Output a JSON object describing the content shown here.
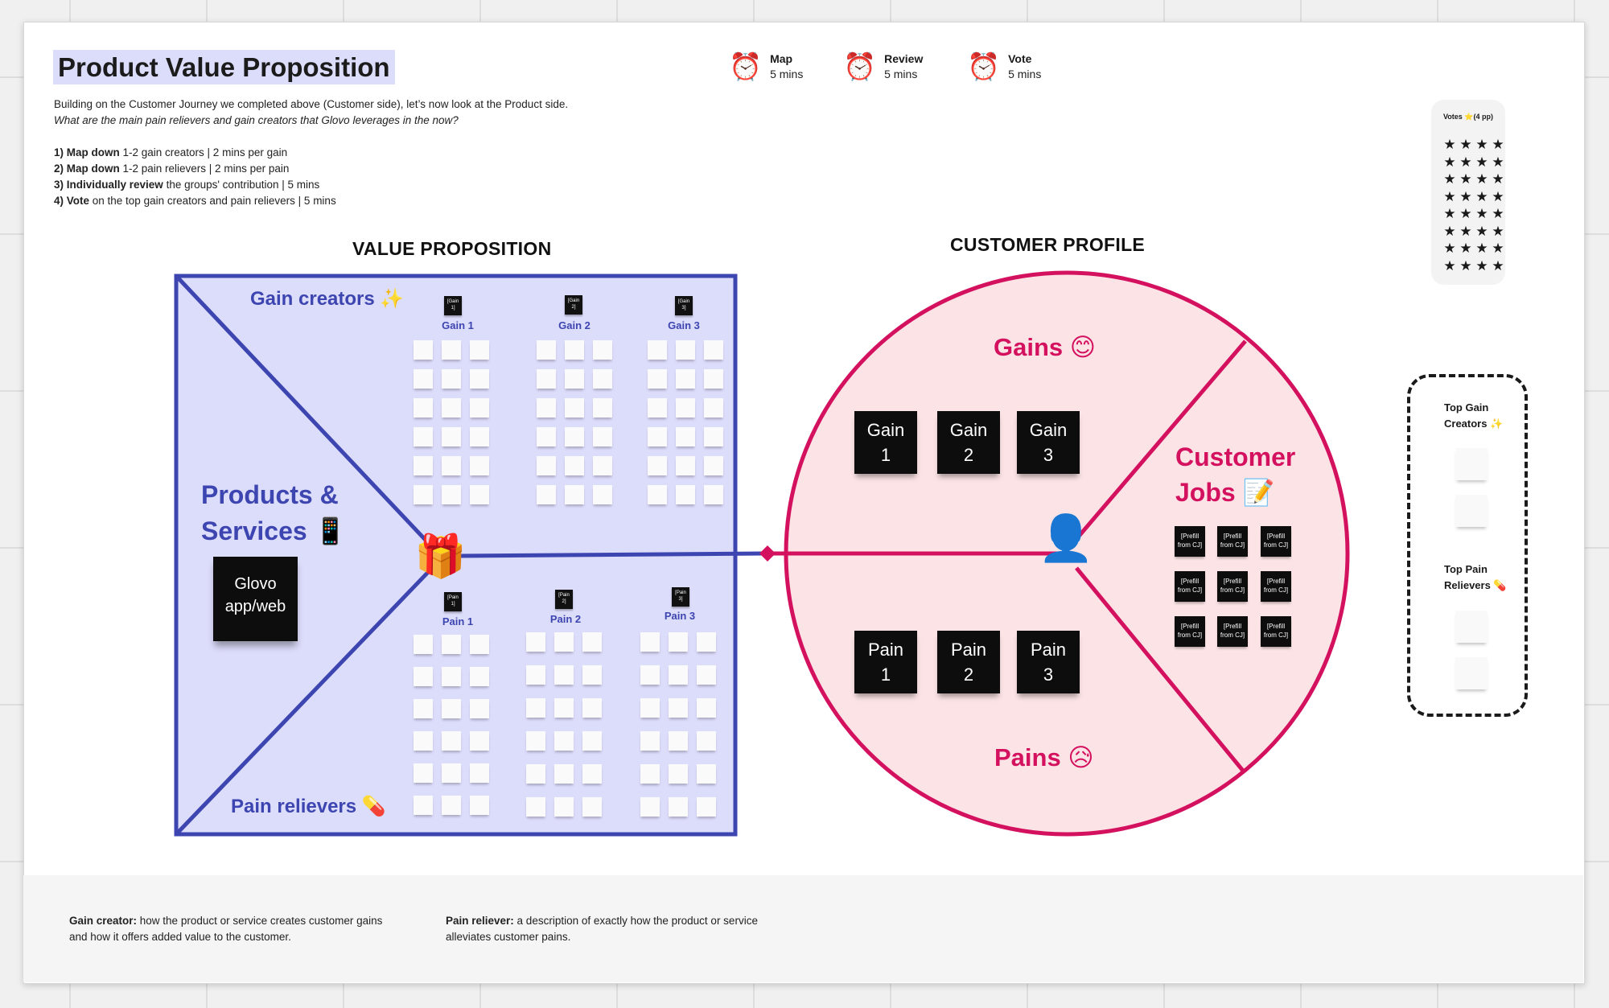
{
  "board": {
    "title": "Product Value Proposition",
    "intro": {
      "line_plain": "Building on the Customer Journey we completed above (Customer side), let’s now look at the Product side. ",
      "line_italic": "What are the main pain relievers and gain creators that Glovo leverages in the now?",
      "steps": [
        {
          "bold": "1) Map down",
          "rest": " 1-2 gain creators | 2 mins per gain"
        },
        {
          "bold": "2) Map down",
          "rest": " 1-2 pain relievers | 2 mins per pain"
        },
        {
          "bold": "3) Individually review",
          "rest": " the groups' contribution | 5 mins"
        },
        {
          "bold": "4) Vote",
          "rest": " on the top gain creators and pain relievers | 5 mins"
        }
      ]
    },
    "timers": [
      {
        "icon": "alarm-clock-icon",
        "glyph": "⏰",
        "label": "Map",
        "value": "5 mins"
      },
      {
        "icon": "alarm-clock-icon",
        "glyph": "⏰",
        "label": "Review",
        "value": "5 mins"
      },
      {
        "icon": "alarm-clock-icon",
        "glyph": "⏰",
        "label": "Vote",
        "value": "5 mins"
      }
    ],
    "votes": {
      "title": "Votes ⭐(4 pp)",
      "star_glyph": "★",
      "rows": 8,
      "per_row": 4
    }
  },
  "value_proposition": {
    "heading": "VALUE PROPOSITION",
    "gain_creators_label": "Gain creators ✨",
    "pain_relievers_label": "Pain relievers 💊",
    "products_label_line1": "Products &",
    "products_label_line2": "Services 📱",
    "product_note_line1": "Glovo",
    "product_note_line2": "app/web",
    "center_icon": "🎁",
    "gain_columns": [
      {
        "label": "Gain 1",
        "tag_line1": "[Gain",
        "tag_line2": "1]"
      },
      {
        "label": "Gain 2",
        "tag_line1": "[Gain",
        "tag_line2": "2]"
      },
      {
        "label": "Gain 3",
        "tag_line1": "[Gain",
        "tag_line2": "3]"
      }
    ],
    "pain_columns": [
      {
        "label": "Pain 1",
        "tag_line1": "[Pain",
        "tag_line2": "1]"
      },
      {
        "label": "Pain 2",
        "tag_line1": "[Pain",
        "tag_line2": "2]"
      },
      {
        "label": "Pain 3",
        "tag_line1": "[Pain",
        "tag_line2": "3]"
      }
    ],
    "notes_per_column": {
      "rows": 6,
      "cols": 3
    },
    "colors": {
      "stroke": "#3d45b0",
      "fill": "#dcdcfb"
    }
  },
  "customer_profile": {
    "heading": "CUSTOMER PROFILE",
    "gains_label": "Gains 😊",
    "pains_label": "Pains 😥",
    "jobs_label_line1": "Customer",
    "jobs_label_line2": "Jobs 📝",
    "center_icon": "👤",
    "gain_notes": [
      {
        "line1": "Gain",
        "line2": "1"
      },
      {
        "line1": "Gain",
        "line2": "2"
      },
      {
        "line1": "Gain",
        "line2": "3"
      }
    ],
    "pain_notes": [
      {
        "line1": "Pain",
        "line2": "1"
      },
      {
        "line1": "Pain",
        "line2": "2"
      },
      {
        "line1": "Pain",
        "line2": "3"
      }
    ],
    "job_notes": [
      "[Prefill from CJ]",
      "[Prefill from CJ]",
      "[Prefill from CJ]",
      "[Prefill from CJ]",
      "[Prefill from CJ]",
      "[Prefill from CJ]",
      "[Prefill from CJ]",
      "[Prefill from CJ]",
      "[Prefill from CJ]"
    ],
    "colors": {
      "stroke": "#d4115f",
      "fill": "#fce4e6"
    }
  },
  "top_panel": {
    "gain_title_line1": "Top Gain",
    "gain_title_line2": "Creators ✨",
    "pain_title_line1": "Top Pain",
    "pain_title_line2": "Relievers 💊"
  },
  "definitions": [
    {
      "term": "Gain creator:",
      "text": " how the product or service creates customer gains and how it offers added value to the customer."
    },
    {
      "term": "Pain reliever:",
      "text": " a description of exactly how the product or service alleviates customer pains."
    }
  ]
}
